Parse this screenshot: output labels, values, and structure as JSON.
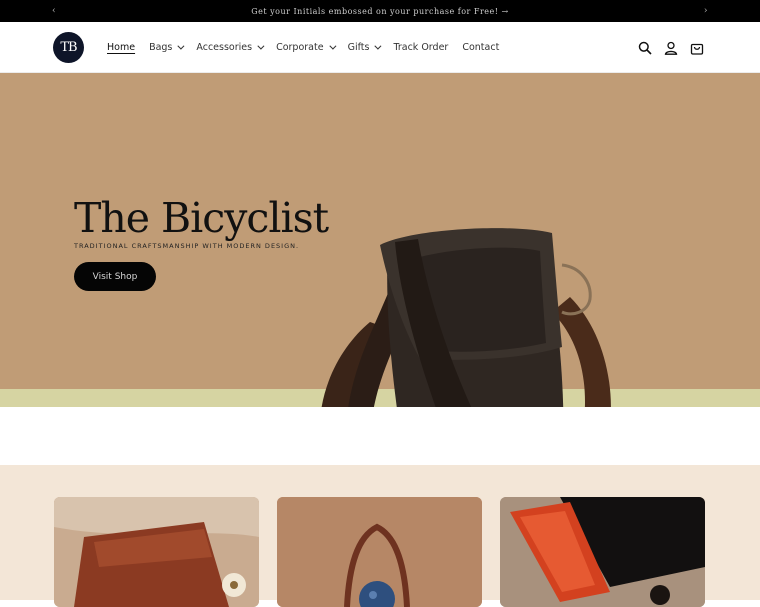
{
  "announcement": {
    "text": "Get your Initials embossed on your purchase for Free! →",
    "prev": "‹",
    "next": "›"
  },
  "header": {
    "logo_text": "TB",
    "nav": [
      {
        "label": "Home"
      },
      {
        "label": "Bags"
      },
      {
        "label": "Accessories"
      },
      {
        "label": "Corporate"
      },
      {
        "label": "Gifts"
      },
      {
        "label": "Track Order"
      },
      {
        "label": "Contact"
      }
    ],
    "icons": [
      "search-icon",
      "account-icon",
      "cart-icon"
    ]
  },
  "hero": {
    "title": "The Bicyclist",
    "subtitle": "TRADITIONAL CRAFTSMANSHIP WITH MODERN DESIGN.",
    "button": "Visit Shop"
  },
  "colors": {
    "announce_bg": "#000000",
    "hero_bg": "#c09c76",
    "collection_bg": "#f3e6d7",
    "button_bg": "#050505"
  }
}
